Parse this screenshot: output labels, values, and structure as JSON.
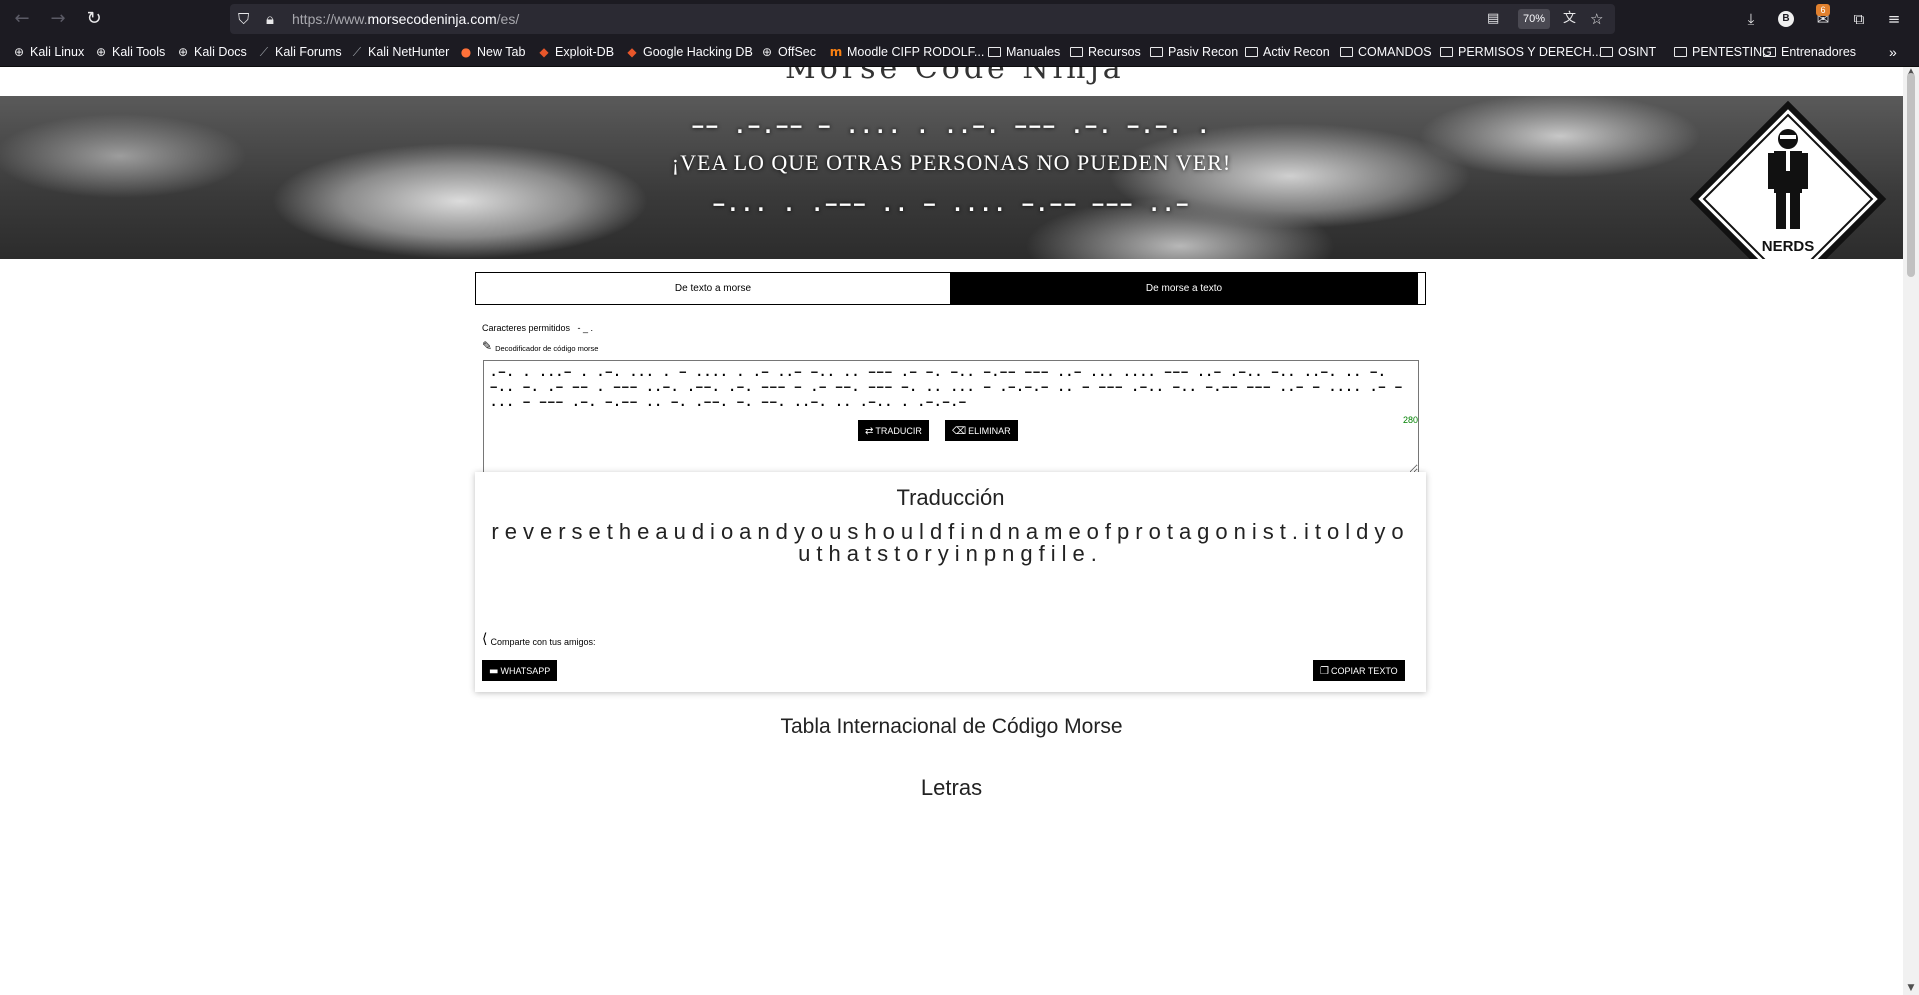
{
  "browser": {
    "url_prefix": "https://www.",
    "url_domain": "morsecodeninja.com",
    "url_suffix": "/es/",
    "zoom": "70%",
    "profile_initial": "B",
    "extension_badge": "6"
  },
  "bookmarks": [
    {
      "label": "Kali Linux",
      "icon": "globe-icon"
    },
    {
      "label": "Kali Tools",
      "icon": "globe-icon"
    },
    {
      "label": "Kali Docs",
      "icon": "globe-icon"
    },
    {
      "label": "Kali Forums",
      "icon": "kali-dragon-icon"
    },
    {
      "label": "Kali NetHunter",
      "icon": "kali-dragon-icon"
    },
    {
      "label": "New Tab",
      "icon": "firefox-icon"
    },
    {
      "label": "Exploit-DB",
      "icon": "exploit-db-icon"
    },
    {
      "label": "Google Hacking DB",
      "icon": "exploit-db-icon"
    },
    {
      "label": "OffSec",
      "icon": "globe-icon"
    },
    {
      "label": "Moodle CIFP RODOLF...",
      "icon": "moodle-icon"
    },
    {
      "label": "Manuales",
      "icon": "folder-icon"
    },
    {
      "label": "Recursos",
      "icon": "folder-icon"
    },
    {
      "label": "Pasiv Recon",
      "icon": "folder-icon"
    },
    {
      "label": "Activ Recon",
      "icon": "folder-icon"
    },
    {
      "label": "COMANDOS",
      "icon": "folder-icon"
    },
    {
      "label": "PERMISOS Y DERECH...",
      "icon": "folder-icon"
    },
    {
      "label": "OSINT",
      "icon": "folder-icon"
    },
    {
      "label": "PENTESTING",
      "icon": "folder-icon"
    },
    {
      "label": "Entrenadores",
      "icon": "folder-icon"
    }
  ],
  "hero": {
    "morse_top": "−− .−.−− − .... . ..−. −−− .−. −.−. .",
    "slogan": "¡VEA LO QUE OTRAS PERSONAS NO PUEDEN VER!",
    "morse_bottom": "−... . .−−− .. − .... −.−− −−− ..−",
    "logo_text": "NERDS"
  },
  "tabs": {
    "text_to_morse": "De texto a morse",
    "morse_to_text": "De morse a texto"
  },
  "decoder": {
    "allowed_label": "Caracteres permitidos",
    "allowed_chars": "- _ .",
    "section_label": "Decodificador de código morse",
    "input_value": ".−. . ...− . .−. ... . − .... . .− ..− −.. .. −−− .− −. −.. −.−− −−− ..− ... .... −−− ..− .−.. −.. ..−. .. −. −.. −. .− −− . −−− ..−. .−−. .−. −−− − .− −−. −−− −. .. ... − .−.−.− .. − −−− .−.. −.. −.−− −−− ..− − .... .− − ... − −−− .−. −.−− .. −. .−−. −. −−. ..−. .. .−.. . .−.−.−",
    "char_count": "280",
    "translate_button": "TRADUCIR",
    "clear_button": "ELIMINAR"
  },
  "result": {
    "title": "Traducción",
    "text": "reversetheaudioandyoushouldfindnameofprotagonist.itoldyouthatstoryinpngfile.",
    "share_label": "Comparte con tus amigos:",
    "whatsapp_button": "WHATSAPP",
    "copy_button": "COPIAR TEXTO"
  },
  "sections": {
    "table_title": "Tabla Internacional de Código Morse",
    "letters_title": "Letras"
  }
}
